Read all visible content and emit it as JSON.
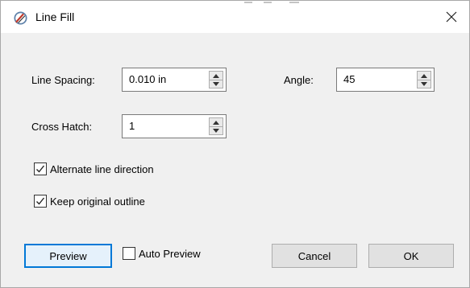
{
  "window": {
    "title": "Line Fill",
    "close_label": "✕"
  },
  "fields": {
    "line_spacing": {
      "label": "Line Spacing:",
      "value": "0.010 in"
    },
    "angle": {
      "label": "Angle:",
      "value": "45"
    },
    "cross_hatch": {
      "label": "Cross Hatch:",
      "value": "1"
    }
  },
  "checkboxes": {
    "alternate": {
      "label": "Alternate line direction",
      "checked": true
    },
    "keep_outline": {
      "label": "Keep original outline",
      "checked": true
    },
    "auto_preview": {
      "label": "Auto Preview",
      "checked": false
    }
  },
  "buttons": {
    "preview": "Preview",
    "cancel": "Cancel",
    "ok": "OK"
  },
  "icons": {
    "app": "line-fill-app-icon",
    "close": "close-icon",
    "spin_up": "spin-up-icon",
    "spin_down": "spin-down-icon",
    "check": "checkmark-icon"
  },
  "colors": {
    "accent": "#0078d7",
    "dialog_bg": "#f0f0f0",
    "button_bg": "#e1e1e1"
  }
}
